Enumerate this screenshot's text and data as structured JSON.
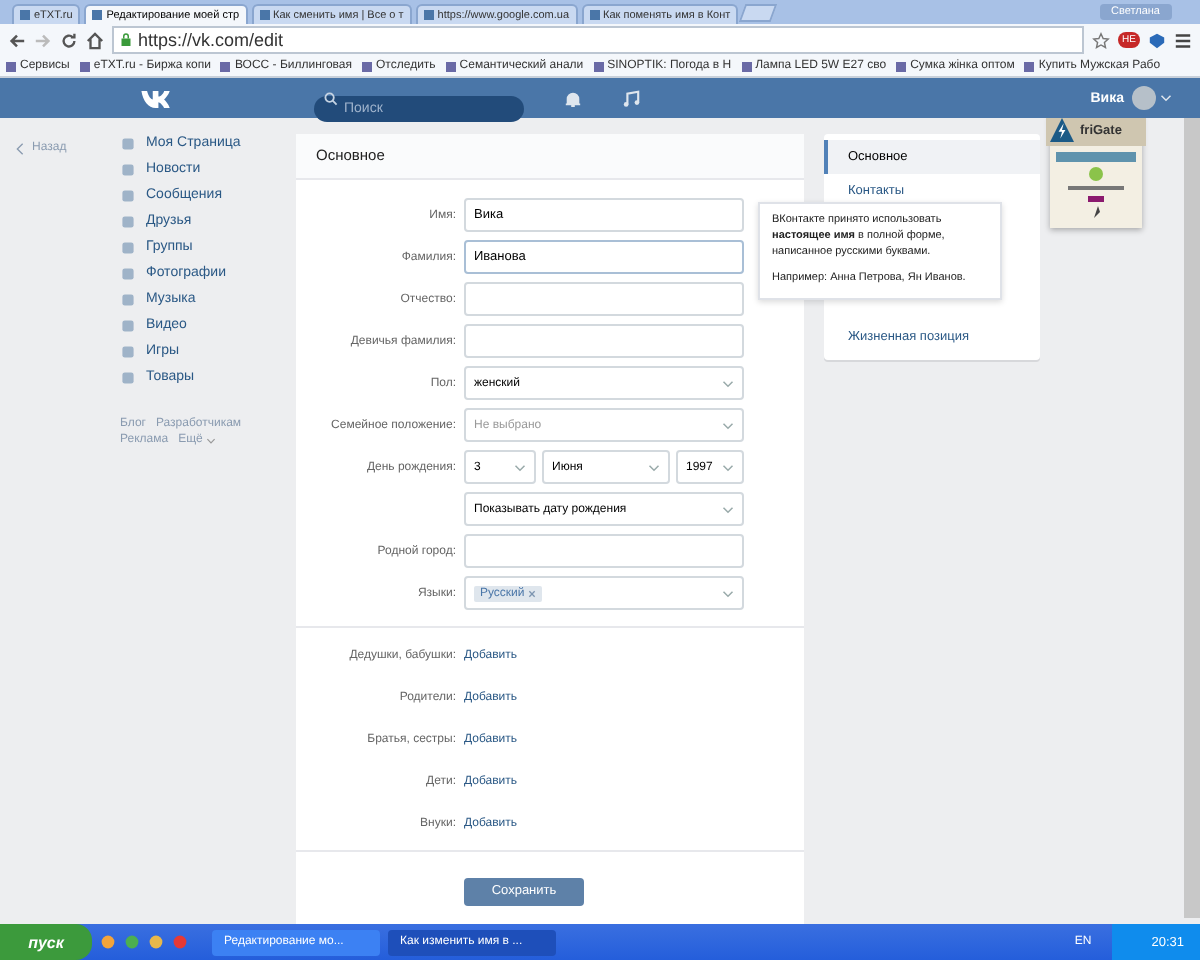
{
  "browser": {
    "tabs": [
      {
        "title": "eTXT.ru",
        "selected": false
      },
      {
        "title": "Редактирование моей стр",
        "selected": true
      },
      {
        "title": "Как сменить имя | Все о т",
        "selected": false
      },
      {
        "title": "https://www.google.com.ua",
        "selected": false
      },
      {
        "title": "Как поменять имя в Конт",
        "selected": false
      }
    ],
    "profile": "Светлана",
    "url": "https://vk.com/edit",
    "extension_badge": "НЕ",
    "bookmarks": [
      "Сервисы",
      "eTXT.ru - Биржа копи",
      "ВОСС - Биллинговая",
      "Отследить",
      "Семантический анали",
      "SINOPTIK: Погода в Н",
      "Лампа LED 5W E27 сво",
      "Сумка жінка оптом",
      "Купить Мужская Рабо"
    ]
  },
  "header": {
    "search": {
      "placeholder": "Поиск"
    },
    "user_name": "Вика"
  },
  "back_link": "Назад",
  "nav": {
    "items": [
      "Моя Страница",
      "Новости",
      "Сообщения",
      "Друзья",
      "Группы",
      "Фотографии",
      "Музыка",
      "Видео",
      "Игры",
      "Товары"
    ],
    "footer": [
      "Блог",
      "Разработчикам",
      "Реклама",
      "Ещё"
    ]
  },
  "form": {
    "title": "Основное",
    "fields": [
      {
        "label": "Имя:",
        "kind": "text",
        "value": "Вика",
        "focused": false
      },
      {
        "label": "Фамилия:",
        "kind": "text",
        "value": "Иванова",
        "focused": true
      },
      {
        "label": "Отчество:",
        "kind": "text",
        "focused": false
      },
      {
        "label": "Девичья фамилия:",
        "kind": "text",
        "focused": false
      },
      {
        "label": "Пол:",
        "kind": "select",
        "value": "женский"
      },
      {
        "label": "Семейное положение:",
        "kind": "select",
        "placeholder": "Не выбрано"
      },
      {
        "label": "День рождения:",
        "kind": "date",
        "parts": [
          "3",
          "Июня",
          "1997"
        ],
        "visibility": "Показывать дату рождения"
      },
      {
        "label": "Родной город:",
        "kind": "text",
        "focused": false
      },
      {
        "label": "Языки:",
        "kind": "tags",
        "tags": [
          "Русский"
        ]
      }
    ],
    "relatives": [
      {
        "label": "Дедушки, бабушки:",
        "action": "Добавить"
      },
      {
        "label": "Родители:",
        "action": "Добавить"
      },
      {
        "label": "Братья, сестры:",
        "action": "Добавить"
      },
      {
        "label": "Дети:",
        "action": "Добавить"
      },
      {
        "label": "Внуки:",
        "action": "Добавить"
      }
    ],
    "save_button": "Сохранить"
  },
  "side_menu": [
    {
      "label": "Основное",
      "selected": true
    },
    {
      "label": "Контакты",
      "selected": false
    },
    {
      "label": "Жизненная позиция",
      "selected": false
    }
  ],
  "tooltip": {
    "text": "ВКонтакте принято использовать **настоящее имя** в полной форме, написанное русскими буквами.",
    "example": "Например: Анна Петрова, Ян Иванов."
  },
  "extension_panel": {
    "title": "friGate"
  },
  "taskbar": {
    "start": "пуск",
    "tasks": [
      {
        "title": "Редактирование мо...",
        "selected": false
      },
      {
        "title": "Как изменить имя в ...",
        "selected": true
      }
    ],
    "language": "EN",
    "time": "20:31"
  }
}
